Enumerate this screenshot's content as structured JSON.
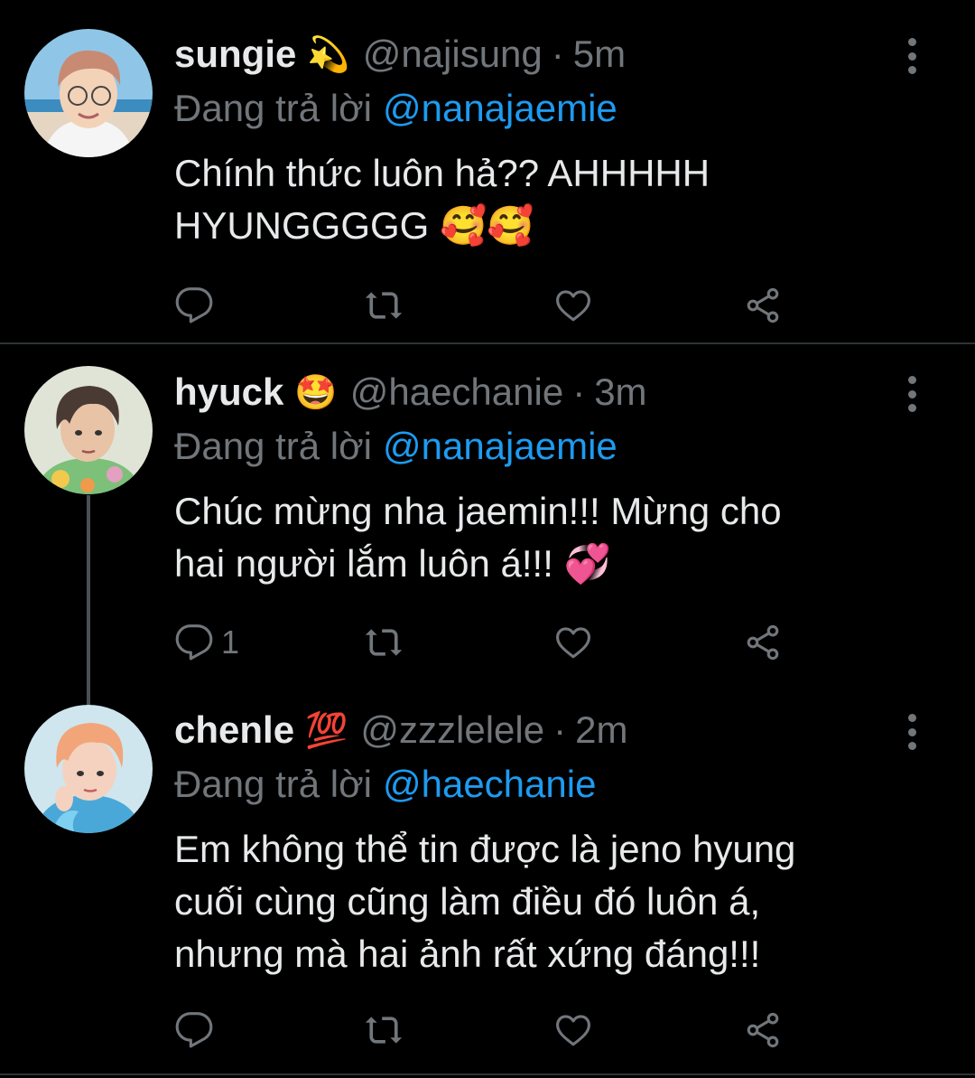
{
  "colors": {
    "background": "#000000",
    "name": "#e7e9ea",
    "muted": "#71767b",
    "mention": "#1d9bf0",
    "divider": "#2f3336"
  },
  "tweets": [
    {
      "name": "sungie",
      "badge": "💫",
      "handle": "@najisung",
      "separator": "·",
      "time": "5m",
      "replying_label": "Đang trả lời",
      "replying_to": "@nanajaemie",
      "text_line1": "Chính thức luôn hả?? AHHHHH",
      "text_line2": "HYUNGGGGG 🥰🥰",
      "reply_count": "",
      "icons": [
        "reply-icon",
        "retweet-icon",
        "like-icon",
        "share-icon",
        "more-icon"
      ]
    },
    {
      "name": "hyuck",
      "badge": "🤩",
      "handle": "@haechanie",
      "separator": "·",
      "time": "3m",
      "replying_label": "Đang trả lời",
      "replying_to": "@nanajaemie",
      "text_line1": "Chúc mừng nha jaemin!!! Mừng cho",
      "text_line2": "hai người lắm luôn á!!! 💞",
      "reply_count": "1",
      "icons": [
        "reply-icon",
        "retweet-icon",
        "like-icon",
        "share-icon",
        "more-icon"
      ]
    },
    {
      "name": "chenle",
      "badge": "💯",
      "handle": "@zzzlelele",
      "separator": "·",
      "time": "2m",
      "replying_label": "Đang trả lời",
      "replying_to": "@haechanie",
      "text_line1": "Em không thể tin được là jeno hyung",
      "text_line2": "cuối cùng cũng làm điều đó luôn á,",
      "text_line3": "nhưng mà hai ảnh rất xứng đáng!!!",
      "reply_count": "",
      "icons": [
        "reply-icon",
        "retweet-icon",
        "like-icon",
        "share-icon",
        "more-icon"
      ]
    }
  ]
}
